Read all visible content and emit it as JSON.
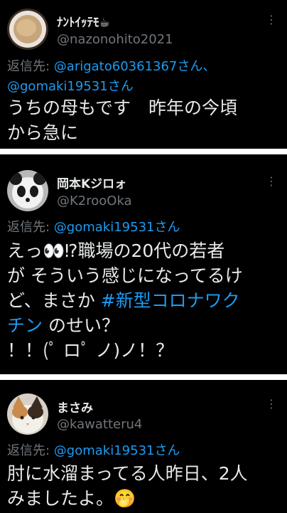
{
  "tweets": [
    {
      "display_name": "ﾅﾝﾄｲｯﾃﾓ☕",
      "handle": "@nazonohito2021",
      "reply_prefix": "返信先: ",
      "reply_link_1": "@arigato60361367さん、",
      "reply_link_2": "@gomaki19531さん",
      "text_line_1": "うちの母もです　昨年の今頃",
      "text_line_2": "から急に"
    },
    {
      "display_name": "岡本Kジロォ",
      "handle": "@K2rooOka",
      "reply_prefix": "返信先: ",
      "reply_link_1": "@gomaki19531さん",
      "text_line_1": "えっ👀⁉職場の20代の若者",
      "text_line_2": "が そういう感じになってるけ",
      "text_line_3_a": "ど、まさか ",
      "hashtag": "#新型コロナワク",
      "text_line_4_hashtag": "チン",
      "text_line_4_rest": " のせい？",
      "text_line_5": "！！(ﾟ ロﾟ ノ)ノ！？"
    },
    {
      "display_name": "まさみ",
      "handle": "@kawatteru4",
      "reply_prefix": "返信先: ",
      "reply_link_1": "@gomaki19531さん",
      "text_line_1": "肘に水溜まってる人昨日、2人",
      "text_line_2": "みましたよ。🤭"
    }
  ],
  "more_icon": "⋮",
  "colors": {
    "accent": "#1d9bf0",
    "muted": "#71767b",
    "text": "#e7e9ea",
    "separator": "#ffffff"
  }
}
